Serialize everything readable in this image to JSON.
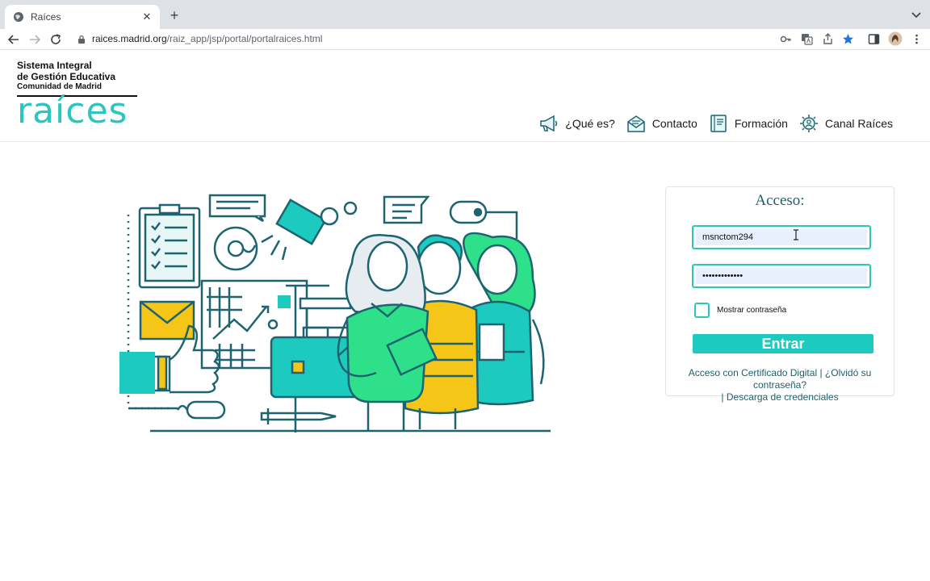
{
  "browser": {
    "tab_title": "Raíces",
    "url_host": "raices.madrid.org",
    "url_path": "/raiz_app/jsp/portal/portalraices.html"
  },
  "logo": {
    "line1": "Sistema Integral",
    "line2": "de Gestión Educativa",
    "line3": "Comunidad de Madrid",
    "wordmark": "raíces"
  },
  "nav": {
    "items": [
      {
        "label": "¿Qué es?",
        "icon": "megaphone-icon"
      },
      {
        "label": "Contacto",
        "icon": "envelope-icon"
      },
      {
        "label": "Formación",
        "icon": "book-icon"
      },
      {
        "label": "Canal Raíces",
        "icon": "network-gear-icon"
      }
    ]
  },
  "login": {
    "title": "Acceso:",
    "username_value": "msnctom294",
    "password_value": "•••••••••••••",
    "show_password_label": "Mostrar contraseña",
    "submit_label": "Entrar",
    "link_certificate": "Acceso con Certificado Digital",
    "link_forgot": "¿Olvidó su contraseña?",
    "link_credentials": "Descarga de credenciales",
    "separator": "|"
  },
  "colors": {
    "accent": "#2bc6bd",
    "button": "#1dcac0",
    "link": "#1f5f6b",
    "illustration_green": "#2ee08a",
    "illustration_yellow": "#f5c518",
    "illustration_dark": "#1d6470"
  }
}
